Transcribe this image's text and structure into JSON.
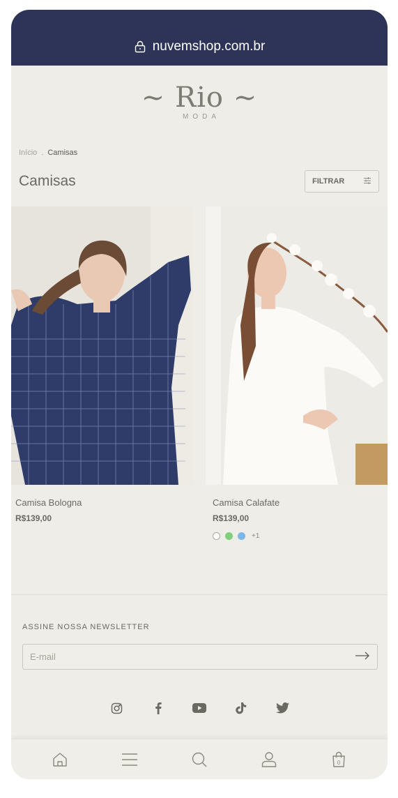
{
  "browser": {
    "url": "nuvemshop.com.br"
  },
  "store": {
    "logo_main": "~ Rio ~",
    "logo_sub": "MODA"
  },
  "breadcrumb": {
    "home": "Início",
    "separator": ".",
    "current": "Camisas"
  },
  "page": {
    "title": "Camisas",
    "filter_label": "FILTRAR"
  },
  "products": [
    {
      "name": "Camisa Bologna",
      "price": "R$139,00"
    },
    {
      "name": "Camisa Calafate",
      "price": "R$139,00",
      "swatches": [
        "#ffffff",
        "#7fd07a",
        "#7bb8ea"
      ],
      "more_colors": "+1"
    }
  ],
  "newsletter": {
    "title": "ASSINE NOSSA NEWSLETTER",
    "email_placeholder": "E-mail"
  },
  "social_icons": [
    "instagram-icon",
    "facebook-icon",
    "youtube-icon",
    "tiktok-icon",
    "twitter-icon"
  ],
  "bottom_nav": [
    "home-icon",
    "menu-icon",
    "search-icon",
    "account-icon",
    "cart-icon"
  ],
  "cart_count": "0",
  "colors": {
    "browser_bar": "#2e3458",
    "page_bg": "#eeede8",
    "text": "#6a6a62"
  }
}
